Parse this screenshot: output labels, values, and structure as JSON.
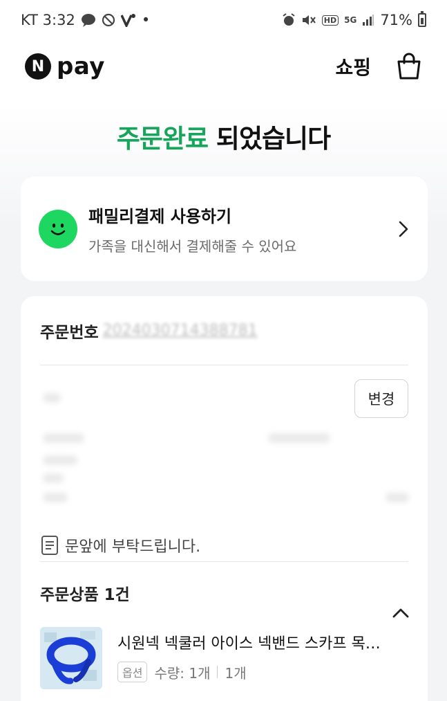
{
  "status_bar": {
    "carrier_time": "KT 3:32",
    "dot": "•",
    "battery": "71%",
    "signal_label": "5G",
    "hd_label": "HD"
  },
  "header": {
    "logo_mark": "N",
    "logo_text": "pay",
    "shop_label": "쇼핑"
  },
  "title": {
    "accent": "주문완료",
    "rest": " 되었습니다"
  },
  "family_pay": {
    "title": "패밀리결제 사용하기",
    "subtitle": "가족을 대신해서 결제해줄 수 있어요"
  },
  "order": {
    "number_label": "주문번호",
    "number_value": "2024030714388781",
    "change_button": "변경",
    "memo": "문앞에 부탁드립니다.",
    "items_title": "주문상품 1건",
    "product": {
      "name": "시원넥 넥쿨러 아이스 넥밴드 스카프 목…",
      "option_badge": "옵션",
      "quantity": "수량: 1개",
      "count": "1개"
    }
  },
  "colors": {
    "accent": "#16a55b",
    "smile": "#1ed760"
  }
}
